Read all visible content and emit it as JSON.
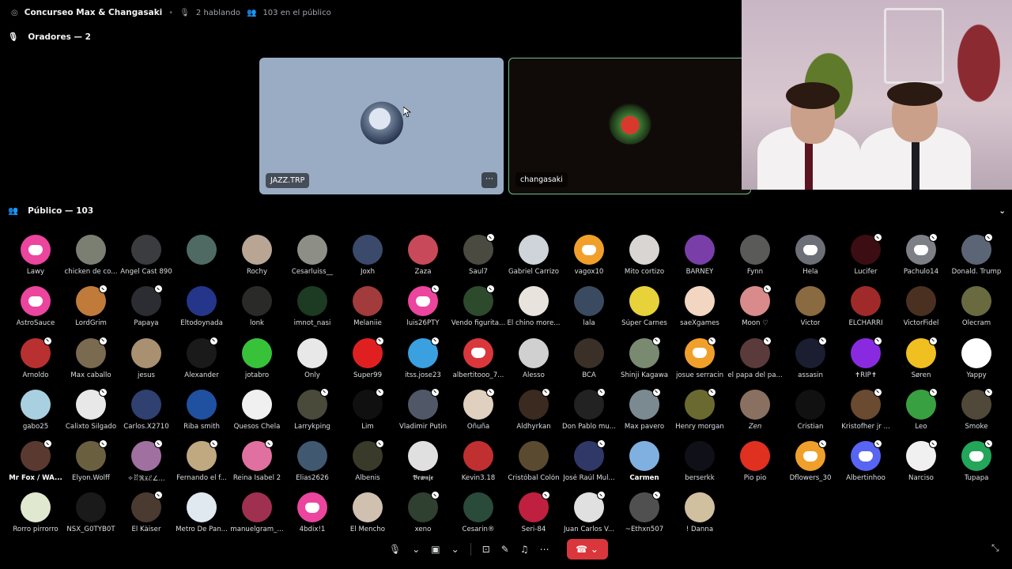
{
  "topbar": {
    "channel_title": "Concurseo Max & Changasaki",
    "speaking": "2 hablando",
    "audience": "103 en el público"
  },
  "speakers": {
    "header": "Oradores — 2",
    "tiles": [
      {
        "name": "JAZZ.TRP"
      },
      {
        "name": "changasaki"
      }
    ]
  },
  "audience": {
    "header": "Público — 103",
    "members": [
      {
        "name": "Lawy",
        "color": "#eb459e",
        "discord": true,
        "muted": false
      },
      {
        "name": "chicken de co...",
        "color": "#7a7f72",
        "muted": false
      },
      {
        "name": "Angel Cast 890",
        "color": "#3a3c40",
        "muted": false
      },
      {
        "name": "",
        "color": "#4e6a63",
        "muted": false
      },
      {
        "name": "Rochy",
        "color": "#b9a594",
        "muted": false
      },
      {
        "name": "Cesarluiss__",
        "color": "#8d8f86",
        "muted": false
      },
      {
        "name": "Joxh",
        "color": "#3b4a6b",
        "muted": false
      },
      {
        "name": "Zaza",
        "color": "#c84a5a",
        "muted": false
      },
      {
        "name": "Saul7",
        "color": "#4a4a40",
        "muted": true
      },
      {
        "name": "Gabriel Carrizo",
        "color": "#cfd3da",
        "muted": false
      },
      {
        "name": "vagox10",
        "color": "#f0a02a",
        "discord": true,
        "muted": false
      },
      {
        "name": "Mito cortizo",
        "color": "#d9d5d2",
        "muted": false
      },
      {
        "name": "BARNEY",
        "color": "#7a3ea8",
        "muted": false
      },
      {
        "name": "Fynn",
        "color": "#5a5a58",
        "muted": false
      },
      {
        "name": "Hela",
        "color": "#6d6f78",
        "discord": true,
        "muted": false
      },
      {
        "name": "Lucifer",
        "color": "#3c0d12",
        "muted": true
      },
      {
        "name": "Pachulo14",
        "color": "#7c7f86",
        "discord": true,
        "muted": true
      },
      {
        "name": "Donald. Trump",
        "color": "#5b6575",
        "muted": true
      },
      {
        "name": "AstroSauce",
        "color": "#eb459e",
        "discord": true,
        "muted": false
      },
      {
        "name": "LordGrim",
        "color": "#c07a3a",
        "muted": true
      },
      {
        "name": "Papaya",
        "color": "#2b2d33",
        "muted": true
      },
      {
        "name": "Eltodoynada",
        "color": "#24358a",
        "muted": false
      },
      {
        "name": "lonk",
        "color": "#2a2a28",
        "muted": false
      },
      {
        "name": "imnot_nasi",
        "color": "#1d3a22",
        "muted": false
      },
      {
        "name": "Melaniie",
        "color": "#a23b3b",
        "muted": false
      },
      {
        "name": "luis26PTY",
        "color": "#eb459e",
        "discord": true,
        "muted": true
      },
      {
        "name": "Vendo figurita...",
        "color": "#2d4a2d",
        "muted": true
      },
      {
        "name": "El chino more...",
        "color": "#e8e3dd",
        "muted": false
      },
      {
        "name": "lala",
        "color": "#3a4a60",
        "muted": false
      },
      {
        "name": "Súper Carnes",
        "color": "#e8d23a",
        "muted": false
      },
      {
        "name": "saeXgames",
        "color": "#f2d6c2",
        "muted": false
      },
      {
        "name": "Moon ♡",
        "color": "#d98a8a",
        "muted": true
      },
      {
        "name": "Victor",
        "color": "#8a6a40",
        "muted": false
      },
      {
        "name": "ELCHARRI",
        "color": "#a02a2a",
        "muted": false
      },
      {
        "name": "VictorFidel",
        "color": "#4a3020",
        "muted": false
      },
      {
        "name": "Olecram",
        "color": "#6a6a40",
        "muted": false
      },
      {
        "name": "Arnoldo",
        "color": "#b83030",
        "muted": true
      },
      {
        "name": "Max caballo",
        "color": "#7a6a50",
        "muted": true
      },
      {
        "name": "jesus",
        "color": "#a89070",
        "muted": false
      },
      {
        "name": "Alexander",
        "color": "#1a1a1a",
        "muted": true
      },
      {
        "name": "jotabro",
        "color": "#38c23a",
        "muted": false
      },
      {
        "name": "Only",
        "color": "#e8e8e8",
        "muted": false
      },
      {
        "name": "Super99",
        "color": "#e02020",
        "muted": true
      },
      {
        "name": "itss.jose23",
        "color": "#3aa0e0",
        "muted": true
      },
      {
        "name": "albertitooo_7...",
        "color": "#da373c",
        "discord": true,
        "muted": false
      },
      {
        "name": "Alesso",
        "color": "#d0d0d0",
        "muted": false
      },
      {
        "name": "BCA",
        "color": "#3a3028",
        "muted": false
      },
      {
        "name": "Shinji Kagawa",
        "color": "#7a8a70",
        "muted": true
      },
      {
        "name": "josue serracin",
        "color": "#f0a02a",
        "discord": true,
        "muted": true
      },
      {
        "name": "el papa del pa...",
        "color": "#5a3a3a",
        "muted": true
      },
      {
        "name": "assasin",
        "color": "#1a1e30",
        "muted": true
      },
      {
        "name": "✝RIP✝",
        "color": "#8a2ae0",
        "muted": true
      },
      {
        "name": "Søren",
        "color": "#f0c020",
        "muted": true
      },
      {
        "name": "Yappy",
        "color": "#ffffff",
        "muted": false
      },
      {
        "name": "gabo25",
        "color": "#a8d0e0",
        "muted": false
      },
      {
        "name": "Calixto Silgado",
        "color": "#e8e8e8",
        "muted": true
      },
      {
        "name": "Carlos.X2710",
        "color": "#304070",
        "muted": false
      },
      {
        "name": "Riba smith",
        "color": "#2050a0",
        "muted": false
      },
      {
        "name": "Quesos Chela",
        "color": "#f0f0f0",
        "muted": false
      },
      {
        "name": "Larrykping",
        "color": "#4a4a3a",
        "muted": true
      },
      {
        "name": "Lim",
        "color": "#101010",
        "muted": true
      },
      {
        "name": "Vladimir Putin",
        "color": "#505868",
        "muted": true
      },
      {
        "name": "Oñuña",
        "color": "#e0d0c0",
        "muted": true
      },
      {
        "name": "Aldhyrkan",
        "color": "#3a2a20",
        "muted": true
      },
      {
        "name": "Don Pablo mu...",
        "color": "#222222",
        "muted": true
      },
      {
        "name": "Max pavero",
        "color": "#7a8a90",
        "muted": true
      },
      {
        "name": "Henry morgan",
        "color": "#6a6a30",
        "muted": true
      },
      {
        "name": "Zen",
        "color": "#8a7060",
        "muted": false,
        "style": "it"
      },
      {
        "name": "Cristian",
        "color": "#111111",
        "muted": false
      },
      {
        "name": "Kristofher jr ...",
        "color": "#6a4a30",
        "muted": true
      },
      {
        "name": "Leo",
        "color": "#38a040",
        "muted": true
      },
      {
        "name": "Smoke",
        "color": "#504838",
        "muted": true
      },
      {
        "name": "Mr Fox / WA...",
        "color": "#5a3a30",
        "muted": true,
        "style": "bold"
      },
      {
        "name": "Elyon.Wolff",
        "color": "#6a6040",
        "muted": true
      },
      {
        "name": "✧ꍏℜ𝔛ℰ∠...",
        "color": "#a070a0",
        "muted": true
      },
      {
        "name": "Fernando el f...",
        "color": "#c0a880",
        "muted": true
      },
      {
        "name": "Reina Isabel 2",
        "color": "#e070a0",
        "muted": true
      },
      {
        "name": "Elias2626",
        "color": "#405870",
        "muted": false
      },
      {
        "name": "Albenis",
        "color": "#3a3a2a",
        "muted": true
      },
      {
        "name": "𝕭𝖗𝖜𝖓𝖏𝖊",
        "color": "#e0e0e0",
        "muted": false
      },
      {
        "name": "Kevin3.18",
        "color": "#c03030",
        "muted": false
      },
      {
        "name": "Cristóbal Colón",
        "color": "#5a4a30",
        "muted": false
      },
      {
        "name": "José Raúl Mul...",
        "color": "#303868",
        "muted": true
      },
      {
        "name": "Carmen",
        "color": "#80b0e0",
        "muted": false,
        "style": "bold"
      },
      {
        "name": "berserkk",
        "color": "#101018",
        "muted": false
      },
      {
        "name": "Pio pio",
        "color": "#e03020",
        "muted": false
      },
      {
        "name": "Dflowers_30",
        "color": "#f0a02a",
        "discord": true,
        "muted": true
      },
      {
        "name": "Albertinhoo",
        "color": "#5865f2",
        "discord": true,
        "muted": true
      },
      {
        "name": "Narciso",
        "color": "#f0f0f0",
        "muted": true
      },
      {
        "name": "Tupapa",
        "color": "#23a55a",
        "discord": true,
        "muted": true
      },
      {
        "name": "Rorro pirrorro",
        "color": "#e0e8d0",
        "muted": false
      },
      {
        "name": "NSX_G0TYB0T",
        "color": "#1a1a1a",
        "muted": false
      },
      {
        "name": "El Kàiser",
        "color": "#4a3a30",
        "muted": true
      },
      {
        "name": "Metro De Pan...",
        "color": "#e0e8f0",
        "muted": false
      },
      {
        "name": "manuelgram_...",
        "color": "#a03050",
        "muted": false
      },
      {
        "name": "4bdix!1",
        "color": "#eb459e",
        "discord": true,
        "muted": false
      },
      {
        "name": "El Mencho",
        "color": "#d0c0b0",
        "muted": false
      },
      {
        "name": "xeno",
        "color": "#304030",
        "muted": true
      },
      {
        "name": "Cesarin®",
        "color": "#2a4a3a",
        "muted": false
      },
      {
        "name": "Seri-84",
        "color": "#c02040",
        "muted": true
      },
      {
        "name": "Juan Carlos V...",
        "color": "#e0e0e0",
        "muted": true
      },
      {
        "name": "~Ethxn507",
        "color": "#505050",
        "muted": true
      },
      {
        "name": "! Danna",
        "color": "#d0c0a0",
        "muted": false
      }
    ]
  },
  "controls": {
    "mic": "mic-icon",
    "camera": "camera-off-icon",
    "share": "screen-share-icon",
    "activities": "activity-icon",
    "sound": "soundboard-icon",
    "more": "⋯",
    "hangup": "hang-up-icon"
  }
}
